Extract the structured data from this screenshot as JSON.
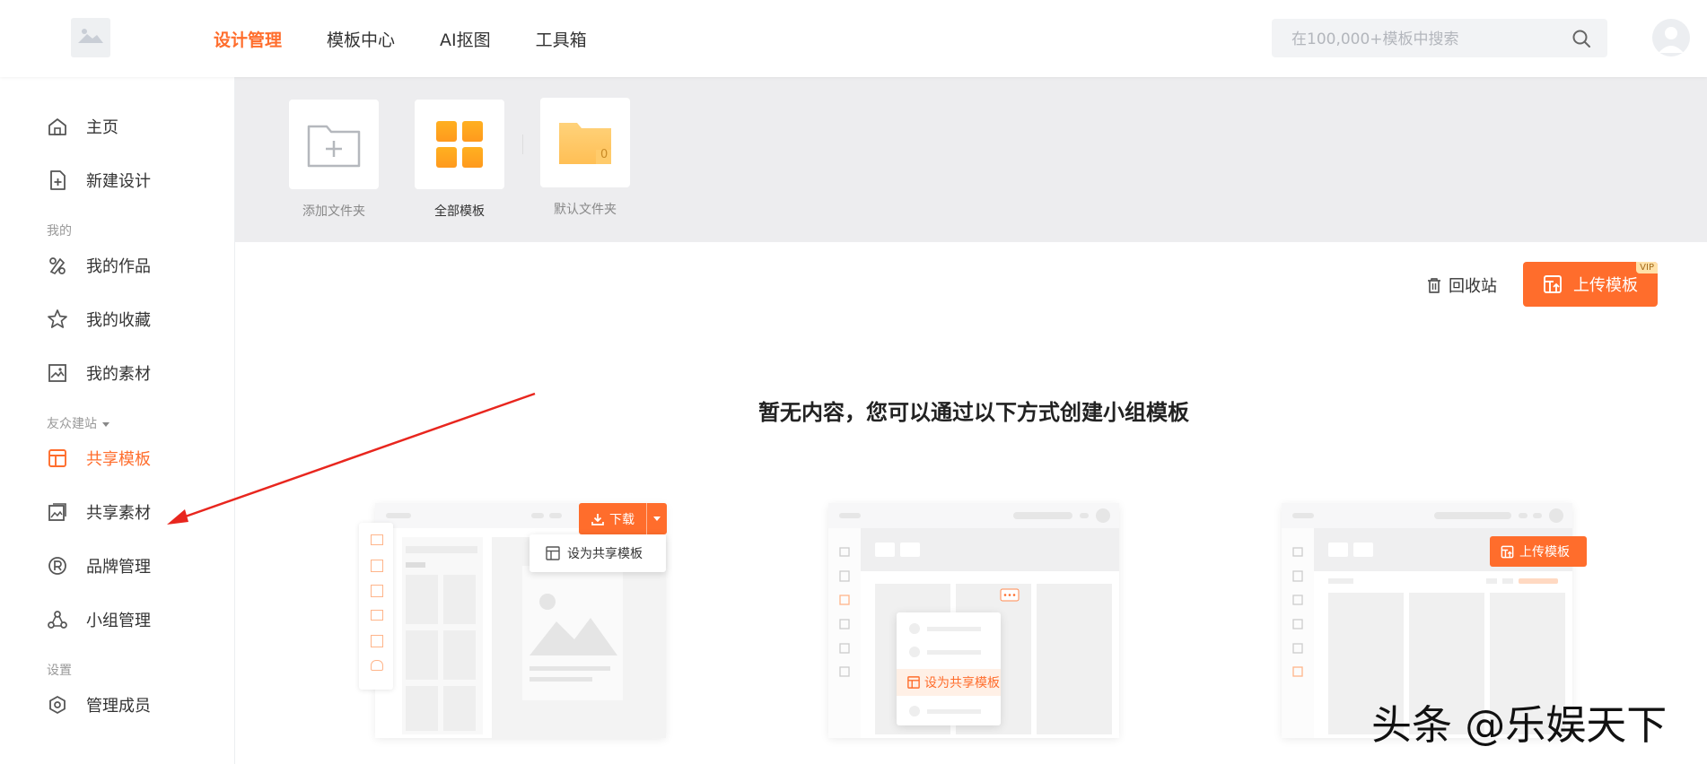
{
  "nav": {
    "items": [
      {
        "label": "设计管理",
        "active": true
      },
      {
        "label": "模板中心",
        "active": false
      },
      {
        "label": "AI抠图",
        "active": false
      },
      {
        "label": "工具箱",
        "active": false
      }
    ]
  },
  "search": {
    "placeholder": "在100,000+模板中搜索",
    "icon": "search-icon"
  },
  "sidebar": {
    "items": [
      {
        "label": "主页",
        "icon": "home-icon"
      },
      {
        "label": "新建设计",
        "icon": "new-file-icon"
      }
    ],
    "sections": [
      {
        "label": "我的",
        "items": [
          {
            "label": "我的作品",
            "icon": "design-tools-icon"
          },
          {
            "label": "我的收藏",
            "icon": "star-icon"
          },
          {
            "label": "我的素材",
            "icon": "image-icon"
          }
        ]
      },
      {
        "label": "友众建站",
        "items": [
          {
            "label": "共享模板",
            "icon": "template-icon",
            "active": true
          },
          {
            "label": "共享素材",
            "icon": "shared-image-icon"
          },
          {
            "label": "品牌管理",
            "icon": "brand-r-icon"
          },
          {
            "label": "小组管理",
            "icon": "group-icon"
          }
        ]
      },
      {
        "label": "设置",
        "items": [
          {
            "label": "管理成员",
            "icon": "hexagon-gear-icon"
          }
        ]
      }
    ]
  },
  "folders": [
    {
      "label": "添加文件夹",
      "icon": "add-folder-icon"
    },
    {
      "label": "全部模板",
      "icon": "grid-icon"
    },
    {
      "label": "默认文件夹",
      "icon": "folder-icon",
      "count": "0"
    }
  ],
  "actions": {
    "recycle": "回收站",
    "upload": "上传模板",
    "vip": "VIP"
  },
  "empty": {
    "title": "暂无内容，您可以通过以下方式创建小组模板"
  },
  "illustrations": {
    "download": "下载",
    "set_shared": "设为共享模板",
    "set_shared_2": "设为共享模板",
    "upload": "上传模板"
  },
  "watermark": "头条 @乐娱天下",
  "colors": {
    "accent": "#ff6d2c",
    "strip_bg": "#ededef",
    "annotation_arrow": "#e8261e"
  }
}
